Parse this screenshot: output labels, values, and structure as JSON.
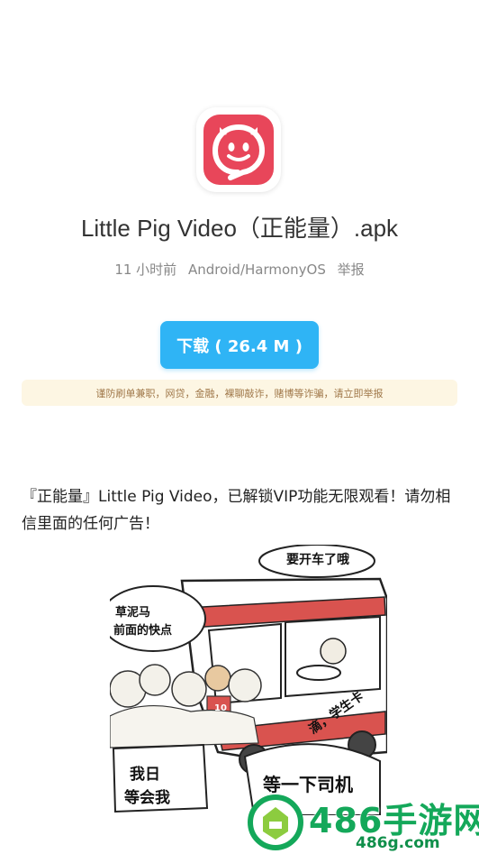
{
  "app": {
    "name": "Little Pig Video（正能量）.apk",
    "time_ago": "11 小时前",
    "platform": "Android/HarmonyOS",
    "report_label": "举报"
  },
  "download": {
    "label": "下载 ( 26.4 M )"
  },
  "warning_text": "谨防刷单兼职，网贷，金融，裸聊敲诈，赌博等诈骗，请立即举报",
  "description": "『正能量』Little Pig Video，已解锁VIP功能无限观看！请勿相信里面的任何广告！",
  "comic": {
    "bubble_top_right": "要开车了哦",
    "bubble_left_line1": "草泥马",
    "bubble_left_line2": "前面的快点",
    "bubble_bottom_left_line1": "我日",
    "bubble_bottom_left_line2": "等会我",
    "bubble_bottom_right": "等一下司机",
    "shout": "滴，学生卡",
    "shirt_number": "10"
  },
  "watermark": {
    "main": "486手游网",
    "sub": "486g.com"
  },
  "colors": {
    "icon_bg": "#e8465a",
    "download_button": "#2fb4f5",
    "warning_bg": "#fdf6e3",
    "watermark_green": "#14a85a"
  },
  "icons": {
    "app_icon": "pig-face-icon",
    "watermark_logo": "486-logo-icon"
  }
}
